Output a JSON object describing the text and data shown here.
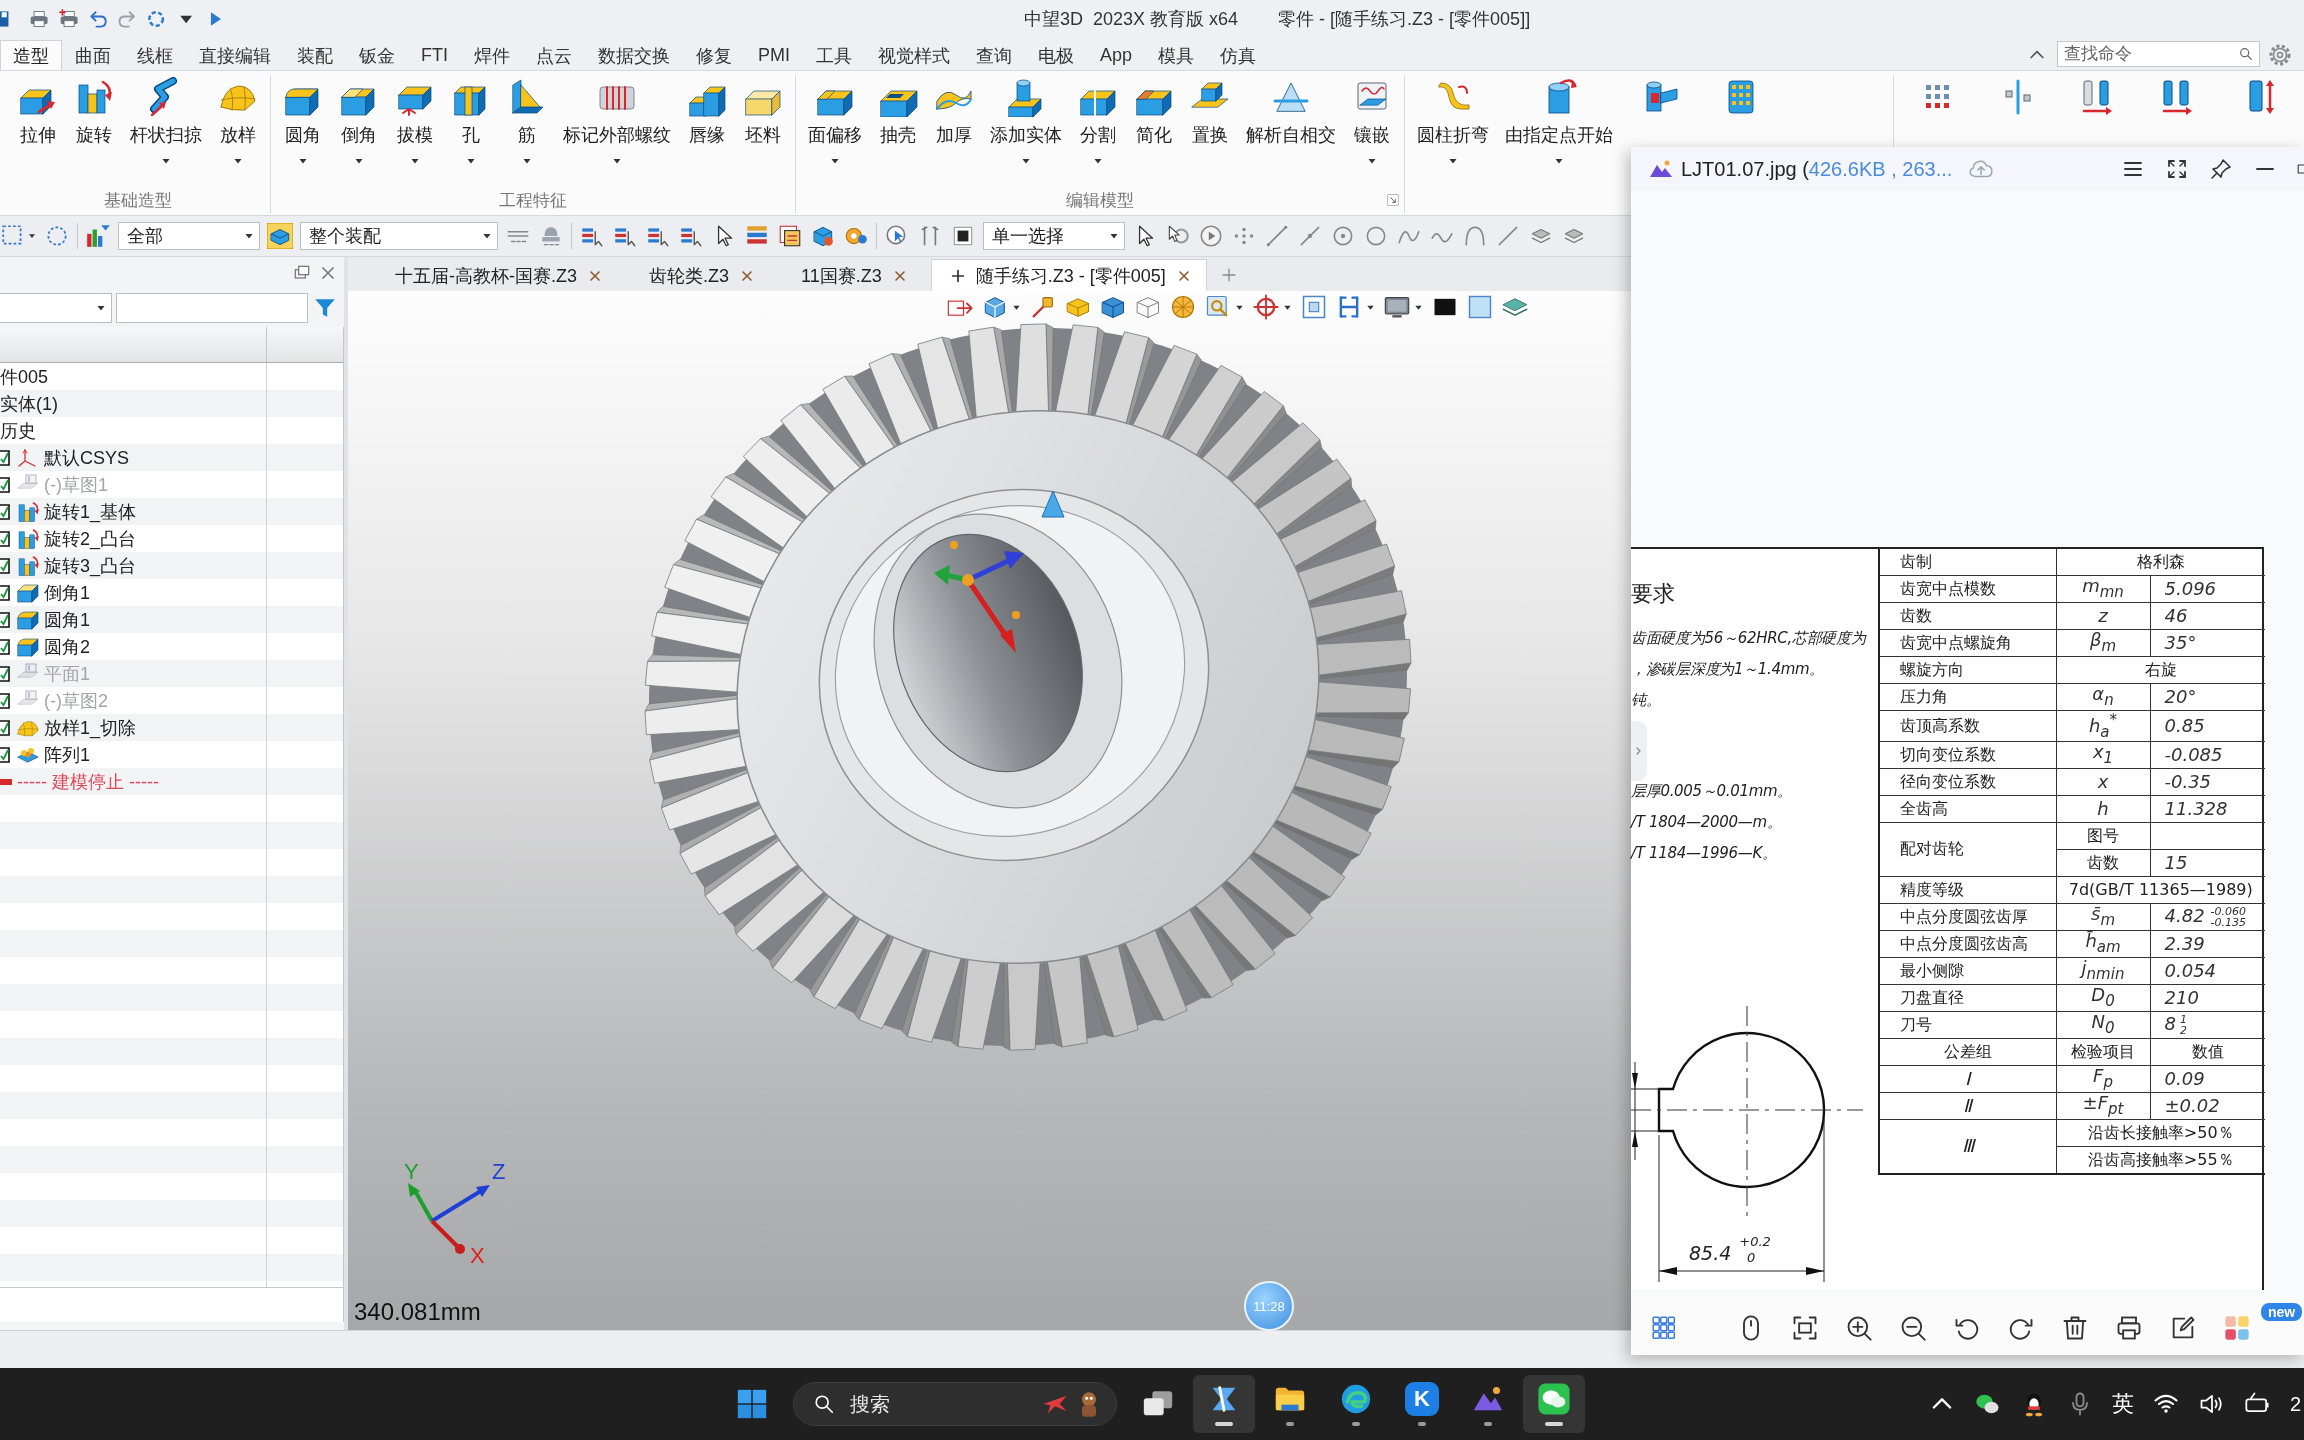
{
  "title_bar": {
    "app_title": "中望3D  2023X 教育版 x64",
    "document_title": "零件 - [随手练习.Z3 - [零件005]]"
  },
  "menu_tabs": [
    {
      "label": "造型",
      "selected": true
    },
    {
      "label": "曲面",
      "selected": false
    },
    {
      "label": "线框",
      "selected": false
    },
    {
      "label": "直接编辑",
      "selected": false
    },
    {
      "label": "装配",
      "selected": false
    },
    {
      "label": "钣金",
      "selected": false
    },
    {
      "label": "FTI",
      "selected": false
    },
    {
      "label": "焊件",
      "selected": false
    },
    {
      "label": "点云",
      "selected": false
    },
    {
      "label": "数据交换",
      "selected": false
    },
    {
      "label": "修复",
      "selected": false
    },
    {
      "label": "PMI",
      "selected": false
    },
    {
      "label": "工具",
      "selected": false
    },
    {
      "label": "视觉样式",
      "selected": false
    },
    {
      "label": "查询",
      "selected": false
    },
    {
      "label": "电极",
      "selected": false
    },
    {
      "label": "App",
      "selected": false
    },
    {
      "label": "模具",
      "selected": false
    },
    {
      "label": "仿真",
      "selected": false
    }
  ],
  "command_search": {
    "placeholder": "查找命令"
  },
  "ribbon": {
    "groups": [
      {
        "label": "基础造型",
        "buttons": [
          {
            "kind": "labeled",
            "label": "拉伸",
            "dropdown": false
          },
          {
            "kind": "labeled",
            "label": "旋转",
            "dropdown": false
          },
          {
            "kind": "labeled",
            "label": "杆状扫掠",
            "dropdown": true
          },
          {
            "kind": "labeled",
            "label": "放样",
            "dropdown": true
          }
        ]
      },
      {
        "label": "工程特征",
        "buttons": [
          {
            "kind": "labeled",
            "label": "圆角",
            "dropdown": true
          },
          {
            "kind": "labeled",
            "label": "倒角",
            "dropdown": true
          },
          {
            "kind": "labeled",
            "label": "拔模",
            "dropdown": true
          },
          {
            "kind": "labeled",
            "label": "孔",
            "dropdown": true
          },
          {
            "kind": "labeled",
            "label": "筋",
            "dropdown": true
          },
          {
            "kind": "labeled",
            "label": "标记外部螺纹",
            "dropdown": true
          },
          {
            "kind": "labeled",
            "label": "唇缘",
            "dropdown": false
          },
          {
            "kind": "labeled",
            "label": "坯料",
            "dropdown": false
          }
        ]
      },
      {
        "label": "编辑模型",
        "dialog_launcher": true,
        "buttons": [
          {
            "kind": "labeled",
            "label": "面偏移",
            "dropdown": true
          },
          {
            "kind": "labeled",
            "label": "抽壳",
            "dropdown": false
          },
          {
            "kind": "labeled",
            "label": "加厚",
            "dropdown": false
          },
          {
            "kind": "labeled",
            "label": "添加实体",
            "dropdown": true
          },
          {
            "kind": "labeled",
            "label": "分割",
            "dropdown": true
          },
          {
            "kind": "labeled",
            "label": "简化",
            "dropdown": false
          },
          {
            "kind": "labeled",
            "label": "置换",
            "dropdown": false
          },
          {
            "kind": "labeled",
            "label": "解析自相交",
            "dropdown": false
          },
          {
            "kind": "labeled",
            "label": "镶嵌",
            "dropdown": true
          }
        ]
      },
      {
        "buttons": [
          {
            "kind": "labeled",
            "label": "圆柱折弯",
            "dropdown": true
          },
          {
            "kind": "labeled",
            "label": "由指定点开始",
            "dropdown": true
          },
          {
            "kind": "icon"
          },
          {
            "kind": "icon"
          }
        ]
      },
      {
        "buttons": [
          {
            "kind": "icon"
          },
          {
            "kind": "icon"
          },
          {
            "kind": "icon"
          },
          {
            "kind": "icon"
          },
          {
            "kind": "icon"
          }
        ]
      }
    ]
  },
  "toolbar": {
    "filter": {
      "value": "全部"
    },
    "scope": {
      "value": "整个装配"
    },
    "selection": {
      "value": "单一选择"
    }
  },
  "feature_tree": {
    "rows": [
      {
        "kind": "node",
        "label": "件005"
      },
      {
        "kind": "node",
        "label": "实体(1)"
      },
      {
        "kind": "node",
        "label": "历史"
      },
      {
        "kind": "feature",
        "label": "默认CSYS",
        "checked": true,
        "dimmed": false
      },
      {
        "kind": "feature",
        "label": "(-)草图1",
        "checked": true,
        "dimmed": true
      },
      {
        "kind": "feature",
        "label": "旋转1_基体",
        "checked": true,
        "dimmed": false
      },
      {
        "kind": "feature",
        "label": "旋转2_凸台",
        "checked": true,
        "dimmed": false
      },
      {
        "kind": "feature",
        "label": "旋转3_凸台",
        "checked": true,
        "dimmed": false
      },
      {
        "kind": "feature",
        "label": "倒角1",
        "checked": true,
        "dimmed": false
      },
      {
        "kind": "feature",
        "label": "圆角1",
        "checked": true,
        "dimmed": false
      },
      {
        "kind": "feature",
        "label": "圆角2",
        "checked": true,
        "dimmed": false
      },
      {
        "kind": "feature",
        "label": "平面1",
        "checked": true,
        "dimmed": true
      },
      {
        "kind": "feature",
        "label": "(-)草图2",
        "checked": true,
        "dimmed": true
      },
      {
        "kind": "feature",
        "label": "放样1_切除",
        "checked": true,
        "dimmed": false
      },
      {
        "kind": "feature",
        "label": "阵列1",
        "checked": true,
        "dimmed": false
      },
      {
        "kind": "stop",
        "label": "----- 建模停止 -----"
      }
    ]
  },
  "document_tabs": [
    {
      "label": "十五届-高教杯-国赛.Z3",
      "selected": false
    },
    {
      "label": "齿轮类.Z3",
      "selected": false
    },
    {
      "label": "11国赛.Z3",
      "selected": false
    },
    {
      "label": "随手练习.Z3 - [零件005]",
      "selected": true
    }
  ],
  "viewport": {
    "axis_labels": [
      "Y",
      "Z",
      "X"
    ],
    "distance": "340.081mm",
    "timer": "11:28"
  },
  "image_viewer": {
    "file_name": "LJT01.07.jpg (",
    "file_info": "426.6KB , 263...",
    "drawing": {
      "heading": "要求",
      "note_blocks": [
        [
          "齿面硬度为56～62HRC,芯部硬度为",
          "，渗碳层深度为1～1.4mm。",
          "钝。"
        ],
        [
          "层厚0.005～0.01mm。",
          "/T 1804—2000—m。",
          "/T 1184—1996—K。"
        ]
      ],
      "dimension": {
        "value": "85.4",
        "upper": "+0.2",
        "lower": "0"
      },
      "table_rows": [
        {
          "kind": "span",
          "label": "齿制",
          "value": "格利森"
        },
        {
          "kind": "param",
          "label": "齿宽中点模数",
          "symbol": "m$_{mn}$",
          "value": "5.096"
        },
        {
          "kind": "param",
          "label": "齿数",
          "symbol": "z",
          "value": "46"
        },
        {
          "kind": "param",
          "label": "齿宽中点螺旋角",
          "symbol": "β$_{m}$",
          "value": "35°"
        },
        {
          "kind": "span",
          "label": "螺旋方向",
          "value": "右旋"
        },
        {
          "kind": "param",
          "label": "压力角",
          "symbol": "α$_{n}$",
          "value": "20°"
        },
        {
          "kind": "param",
          "label": "齿顶高系数",
          "symbol": "h$_{a}$$^{*}$",
          "value": "0.85"
        },
        {
          "kind": "param",
          "label": "切向变位系数",
          "symbol": "x$_{1}$",
          "value": "-0.085"
        },
        {
          "kind": "param",
          "label": "径向变位系数",
          "symbol": "x",
          "value": "-0.35"
        },
        {
          "kind": "param",
          "label": "全齿高",
          "symbol": "h",
          "value": "11.328"
        },
        {
          "kind": "pair",
          "label": "配对齿轮",
          "subrows": [
            {
              "name": "图号"
            },
            {
              "name": "齿数",
              "value": "15"
            }
          ]
        },
        {
          "kind": "span",
          "label": "精度等级",
          "value": "7d(GB/T 11365—1989)"
        },
        {
          "kind": "param",
          "label": "中点分度圆弦齿厚",
          "symbol": "s̄$_{m}$",
          "value": "4.82",
          "tolerance": [
            "-0.060",
            "-0.135"
          ]
        },
        {
          "kind": "param",
          "label": "中点分度圆弦齿高",
          "symbol": "h̄$_{am}$",
          "value": "2.39"
        },
        {
          "kind": "param",
          "label": "最小侧隙",
          "symbol": "j$_{nmin}$",
          "value": "0.054"
        },
        {
          "kind": "param",
          "label": "刀盘直径",
          "symbol": "D$_{0}$",
          "value": "210"
        },
        {
          "kind": "param",
          "label": "刀号",
          "symbol": "N$_{0}$",
          "value": "8",
          "fraction": [
            "1",
            "2"
          ]
        },
        {
          "kind": "header",
          "cells": [
            "公差组",
            "检验项目",
            "数值"
          ]
        },
        {
          "kind": "tolerance",
          "label": "Ⅰ",
          "symbol": "F$_{p}$",
          "value": "0.09"
        },
        {
          "kind": "tolerance",
          "label": "Ⅱ",
          "symbol": "±F$_{pt}$",
          "value": "±0.02"
        },
        {
          "kind": "multi",
          "label": "Ⅲ",
          "values": [
            "沿齿长接触率>50％",
            "沿齿高接触率>55％"
          ]
        }
      ]
    },
    "new_badge": "new"
  },
  "taskbar": {
    "search": {
      "placeholder": "搜索"
    },
    "apps": [
      {
        "selected": true
      },
      {
        "selected": false
      },
      {
        "selected": false
      },
      {
        "selected": false,
        "letter": "K"
      },
      {
        "selected": false
      },
      {
        "selected": true
      }
    ],
    "input_method": "英",
    "clock": "2"
  }
}
